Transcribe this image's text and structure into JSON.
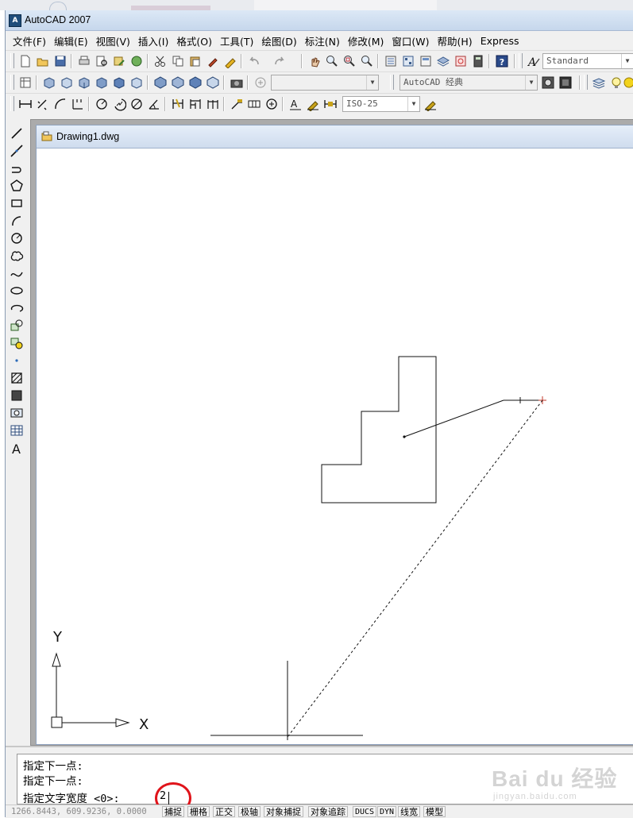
{
  "window": {
    "title": "AutoCAD 2007"
  },
  "menu": [
    "文件(F)",
    "编辑(E)",
    "视图(V)",
    "插入(I)",
    "格式(O)",
    "工具(T)",
    "绘图(D)",
    "标注(N)",
    "修改(M)",
    "窗口(W)",
    "帮助(H)",
    "Express"
  ],
  "toolbars": {
    "text_style": "Standard",
    "layer": "",
    "workspace": "AutoCAD 经典",
    "dim_style": "ISO-25"
  },
  "document": {
    "name": "Drawing1.dwg"
  },
  "ucs": {
    "y_label": "Y",
    "x_label": "X"
  },
  "command": {
    "history": [
      "指定下一点:",
      "指定下一点:"
    ],
    "prompt": "指定文字宽度 <0>:",
    "input": "2"
  },
  "status": {
    "coords": "1266.8443, 609.9236, 0.0000",
    "buttons": [
      "捕捉",
      "栅格",
      "正交",
      "极轴",
      "对象捕捉",
      "对象追踪",
      "DUCS",
      "DYN",
      "线宽",
      "模型"
    ]
  },
  "watermark": {
    "brand": "Bai du 经验",
    "url": "jingyan.baidu.com"
  },
  "colors": {
    "highlight_circle": "#e0141b",
    "title_bar": "#c6d7ec"
  }
}
